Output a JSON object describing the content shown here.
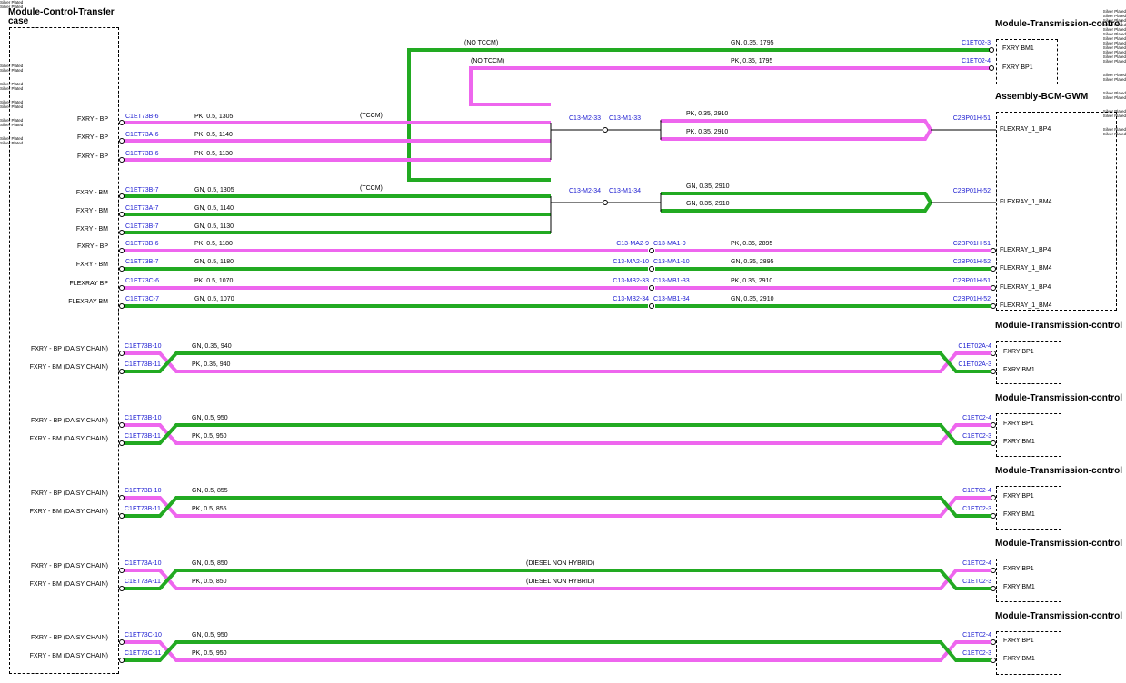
{
  "colors": {
    "green": "#22aa22",
    "pink": "#ee66ee",
    "conn": "#1a1ad0"
  },
  "modules": {
    "tcase": "Module-Control-Transfer case",
    "tcm": "Module-Transmission-control",
    "bcm": "Assembly-BCM-GWM"
  },
  "silver": "Silver Plated",
  "top_runs": {
    "gn_label": "GN, 0.35, 1795",
    "pk_label": "PK, 0.35, 1795",
    "no_tccm": "(NO TCCM)",
    "tccm": "(TCCM)",
    "tcm_conn_gn": "C1ET02-3",
    "tcm_conn_pk": "C1ET02-4",
    "tcm_pin_bm": "FXRY BM1",
    "tcm_pin_bp": "FXRY BP1"
  },
  "bp_group": {
    "pins": [
      "FXRY - BP",
      "FXRY - BP",
      "FXRY - BP"
    ],
    "conns": [
      "C1ET73B-6",
      "C1ET73A-6",
      "C1ET73B-6"
    ],
    "wires": [
      "PK, 0.5, 1305",
      "PK, 0.5, 1140",
      "PK, 0.5, 1130"
    ],
    "splice_a": "C13-M2-33",
    "splice_b": "C13-M1-33",
    "right_top": "PK, 0.35, 2910",
    "right_bot": "PK, 0.35, 2910",
    "bcm_conn": "C2BP01H-51",
    "bcm_pin": "FLEXRAY_1_BP4"
  },
  "bm_group": {
    "pins": [
      "FXRY - BM",
      "FXRY - BM",
      "FXRY - BM"
    ],
    "conns": [
      "C1ET73B-7",
      "C1ET73A-7",
      "C1ET73B-7"
    ],
    "wires": [
      "GN, 0.5, 1305",
      "GN, 0.5, 1140",
      "GN, 0.5, 1130"
    ],
    "splice_a": "C13-M2-34",
    "splice_b": "C13-M1-34",
    "right_top": "GN, 0.35, 2910",
    "right_bot": "GN, 0.35, 2910",
    "bcm_conn": "C2BP01H-52",
    "bcm_pin": "FLEXRAY_1_BM4"
  },
  "singles": [
    {
      "pin": "FXRY - BP",
      "conn": "C1ET73B-6",
      "wire": "PK, 0.5, 1180",
      "sa": "C13-MA2-9",
      "sb": "C13-MA1-9",
      "wire2": "PK, 0.35, 2895",
      "bconn": "C2BP01H-51",
      "bpin": "FLEXRAY_1_BP4"
    },
    {
      "pin": "FXRY - BM",
      "conn": "C1ET73B-7",
      "wire": "GN, 0.5, 1180",
      "sa": "C13-MA2-10",
      "sb": "C13-MA1-10",
      "wire2": "GN, 0.35, 2895",
      "bconn": "C2BP01H-52",
      "bpin": "FLEXRAY_1_BM4"
    },
    {
      "pin": "FLEXRAY BP",
      "conn": "C1ET73C-6",
      "wire": "PK, 0.5, 1070",
      "sa": "C13-MB2-33",
      "sb": "C13-MB1-33",
      "wire2": "PK, 0.35, 2910",
      "bconn": "C2BP01H-51",
      "bpin": "FLEXRAY_1_BP4"
    },
    {
      "pin": "FLEXRAY BM",
      "conn": "C1ET73C-7",
      "wire": "GN, 0.5, 1070",
      "sa": "C13-MB2-34",
      "sb": "C13-MB1-34",
      "wire2": "GN, 0.35, 2910",
      "bconn": "C2BP01H-52",
      "bpin": "FLEXRAY_1_BM4"
    }
  ],
  "daisy": [
    {
      "p1": "FXRY - BP (DAISY CHAIN)",
      "p2": "FXRY - BM (DAISY CHAIN)",
      "c1": "C1ET73B-10",
      "c2": "C1ET73B-11",
      "w1": "GN, 0.35, 940",
      "w2": "PK, 0.35, 940",
      "note": "",
      "r1": "C1ET02A-4",
      "r2": "C1ET02A-3",
      "t1": "FXRY BP1",
      "t2": "FXRY BM1"
    },
    {
      "p1": "FXRY - BP (DAISY CHAIN)",
      "p2": "FXRY - BM (DAISY CHAIN)",
      "c1": "C1ET73B-10",
      "c2": "C1ET73B-11",
      "w1": "GN, 0.5, 950",
      "w2": "PK, 0.5, 950",
      "note": "",
      "r1": "C1ET02-4",
      "r2": "C1ET02-3",
      "t1": "FXRY BP1",
      "t2": "FXRY BM1"
    },
    {
      "p1": "FXRY - BP (DAISY CHAIN)",
      "p2": "FXRY - BM (DAISY CHAIN)",
      "c1": "C1ET73B-10",
      "c2": "C1ET73B-11",
      "w1": "GN, 0.5, 855",
      "w2": "PK, 0.5, 855",
      "note": "",
      "r1": "C1ET02-4",
      "r2": "C1ET02-3",
      "t1": "FXRY BP1",
      "t2": "FXRY BM1"
    },
    {
      "p1": "FXRY - BP (DAISY CHAIN)",
      "p2": "FXRY - BM (DAISY CHAIN)",
      "c1": "C1ET73A-10",
      "c2": "C1ET73A-11",
      "w1": "GN, 0.5, 850",
      "w2": "PK, 0.5, 850",
      "note": "(DIESEL NON HYBRID)",
      "r1": "C1ET02-4",
      "r2": "C1ET02-3",
      "t1": "FXRY BP1",
      "t2": "FXRY BM1"
    },
    {
      "p1": "FXRY - BP (DAISY CHAIN)",
      "p2": "FXRY - BM (DAISY CHAIN)",
      "c1": "C1ET73C-10",
      "c2": "C1ET73C-11",
      "w1": "GN, 0.5, 950",
      "w2": "PK, 0.5, 950",
      "note": "",
      "r1": "C1ET02-4",
      "r2": "C1ET02-3",
      "t1": "FXRY BP1",
      "t2": "FXRY BM1"
    }
  ]
}
